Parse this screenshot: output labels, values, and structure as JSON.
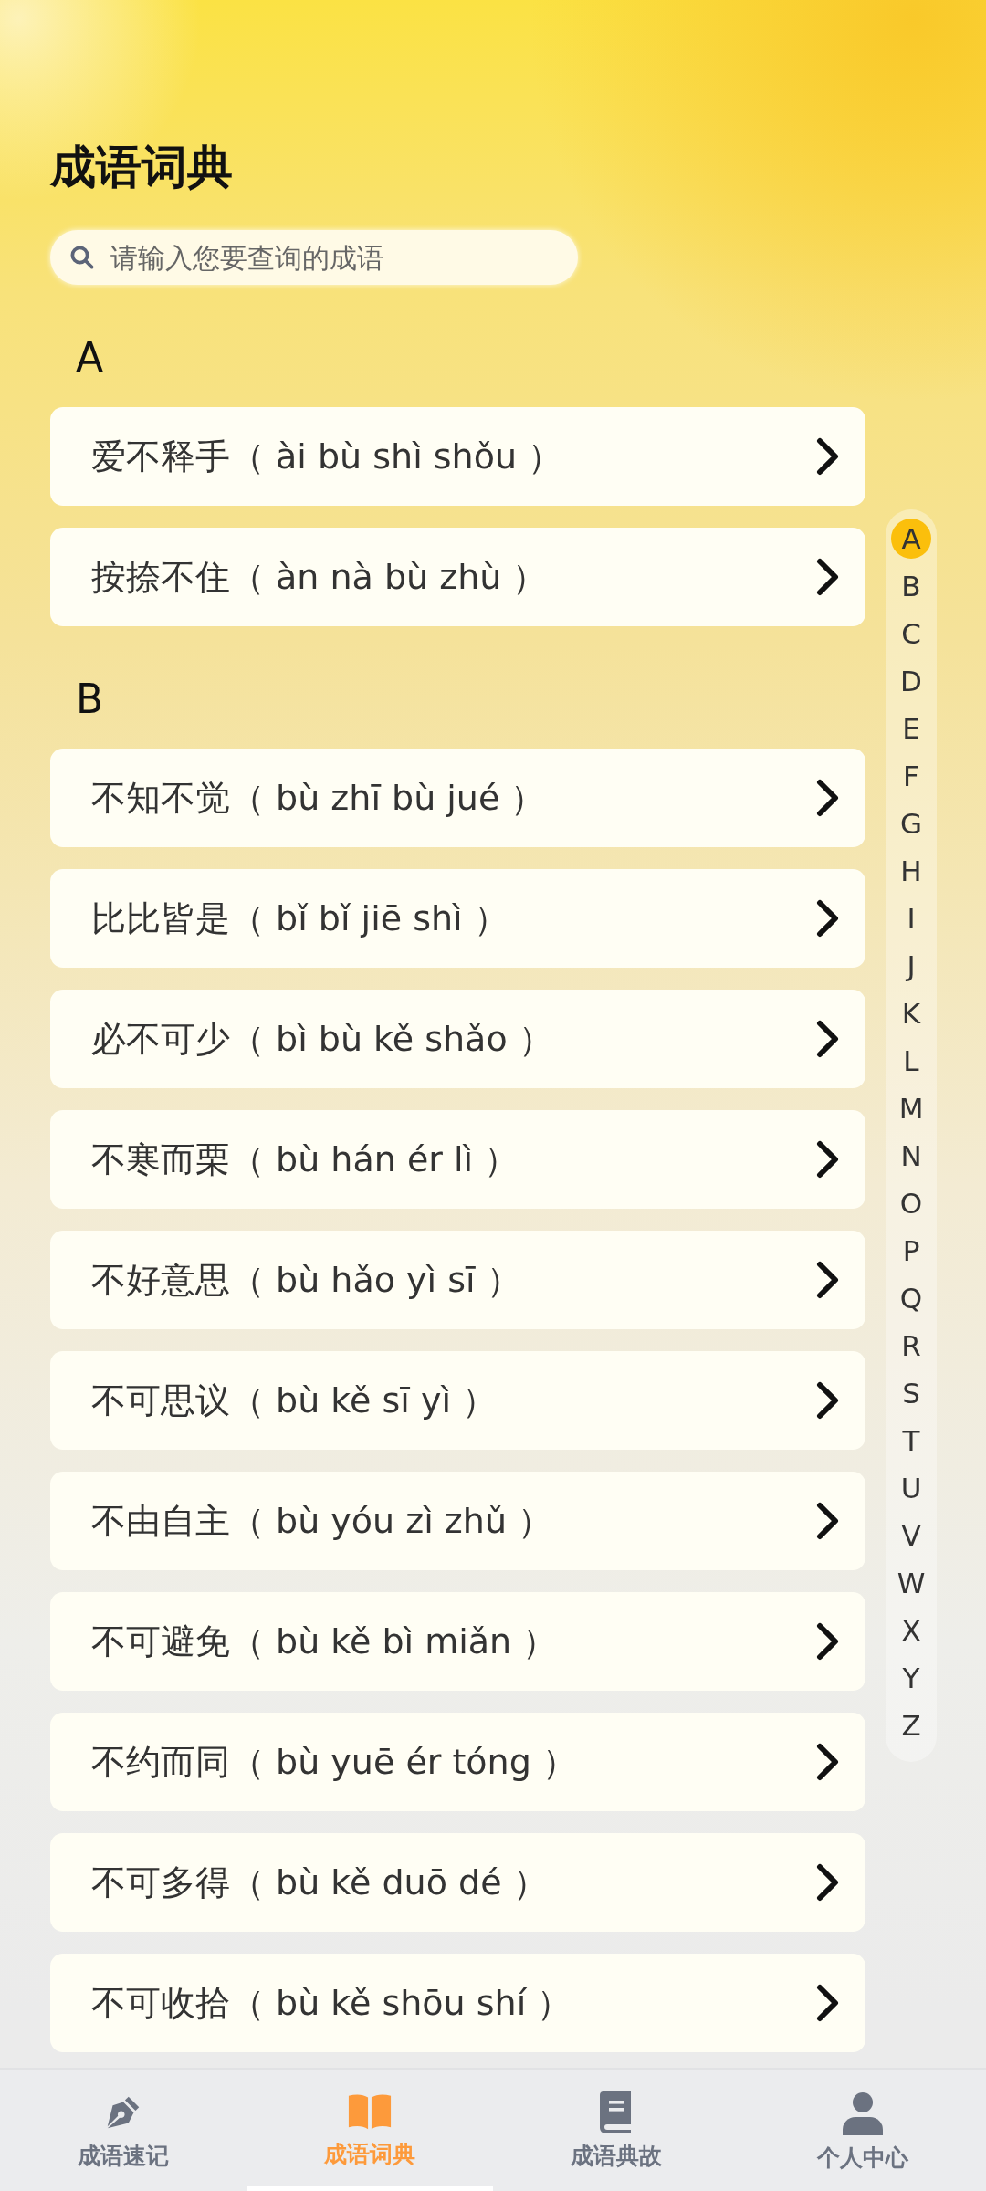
{
  "title": "成语词典",
  "search": {
    "placeholder": "请输入您要查询的成语"
  },
  "sections": [
    {
      "letter": "A",
      "items": [
        {
          "text": "爱不释手（ ài bù shì shǒu ）"
        },
        {
          "text": "按捺不住（ àn nà bù zhù ）"
        }
      ]
    },
    {
      "letter": "B",
      "items": [
        {
          "text": "不知不觉（ bù zhī bù jué ）"
        },
        {
          "text": "比比皆是（ bǐ bǐ jiē shì ）"
        },
        {
          "text": "必不可少（ bì bù kě shǎo ）"
        },
        {
          "text": "不寒而栗（ bù hán ér lì ）"
        },
        {
          "text": "不好意思（ bù hǎo yì sī ）"
        },
        {
          "text": "不可思议（ bù kě sī yì ）"
        },
        {
          "text": "不由自主（ bù yóu zì zhǔ ）"
        },
        {
          "text": "不可避免（ bù kě bì miǎn ）"
        },
        {
          "text": "不约而同（ bù yuē ér tóng ）"
        },
        {
          "text": "不可多得（ bù kě duō dé ）"
        },
        {
          "text": "不可收拾（ bù kě shōu shí ）"
        }
      ]
    }
  ],
  "index": [
    {
      "letter": "A",
      "selected": true
    },
    {
      "letter": "B",
      "selected": false
    },
    {
      "letter": "C",
      "selected": false
    },
    {
      "letter": "D",
      "selected": false
    },
    {
      "letter": "E",
      "selected": false
    },
    {
      "letter": "F",
      "selected": false
    },
    {
      "letter": "G",
      "selected": false
    },
    {
      "letter": "H",
      "selected": false
    },
    {
      "letter": "I",
      "selected": false
    },
    {
      "letter": "J",
      "selected": false
    },
    {
      "letter": "K",
      "selected": false
    },
    {
      "letter": "L",
      "selected": false
    },
    {
      "letter": "M",
      "selected": false
    },
    {
      "letter": "N",
      "selected": false
    },
    {
      "letter": "O",
      "selected": false
    },
    {
      "letter": "P",
      "selected": false
    },
    {
      "letter": "Q",
      "selected": false
    },
    {
      "letter": "R",
      "selected": false
    },
    {
      "letter": "S",
      "selected": false
    },
    {
      "letter": "T",
      "selected": false
    },
    {
      "letter": "U",
      "selected": false
    },
    {
      "letter": "V",
      "selected": false
    },
    {
      "letter": "W",
      "selected": false
    },
    {
      "letter": "X",
      "selected": false
    },
    {
      "letter": "Y",
      "selected": false
    },
    {
      "letter": "Z",
      "selected": false
    }
  ],
  "nav": [
    {
      "kind": "pen",
      "label": "成语速记",
      "selected": false
    },
    {
      "kind": "book",
      "label": "成语词典",
      "selected": true
    },
    {
      "kind": "story",
      "label": "成语典故",
      "selected": false
    },
    {
      "kind": "person",
      "label": "个人中心",
      "selected": false
    }
  ]
}
